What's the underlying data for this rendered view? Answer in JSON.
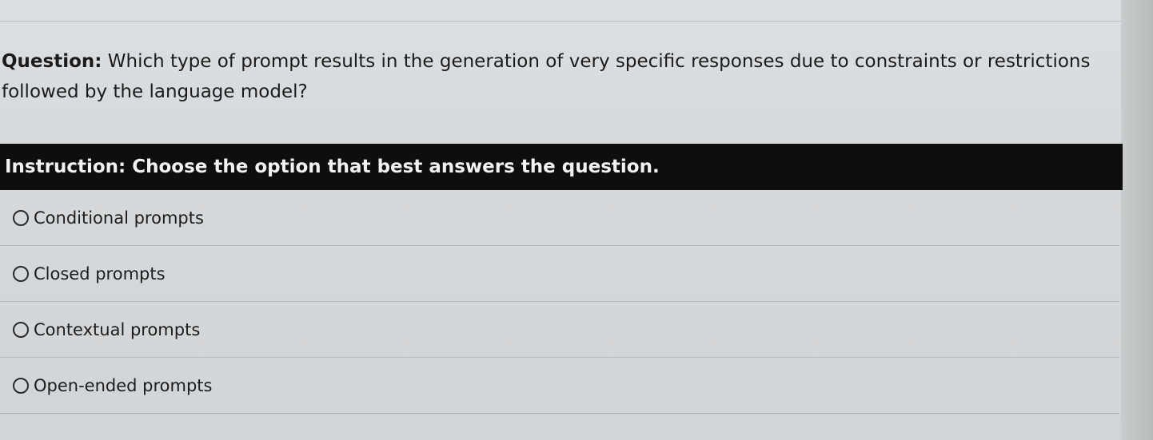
{
  "question": {
    "label": "Question:",
    "text": "Which type of prompt results in the generation of very specific responses due to constraints or restrictions followed by the language model?"
  },
  "instruction": {
    "text": "Instruction: Choose the option that best answers the question."
  },
  "options": [
    {
      "label": "Conditional prompts",
      "selected": false
    },
    {
      "label": "Closed prompts",
      "selected": false
    },
    {
      "label": "Contextual prompts",
      "selected": false
    },
    {
      "label": "Open-ended prompts",
      "selected": false
    }
  ],
  "colors": {
    "background": "#d6d9db",
    "instruction_bar": "#0e0e0e",
    "instruction_text": "#f2f2f2"
  }
}
